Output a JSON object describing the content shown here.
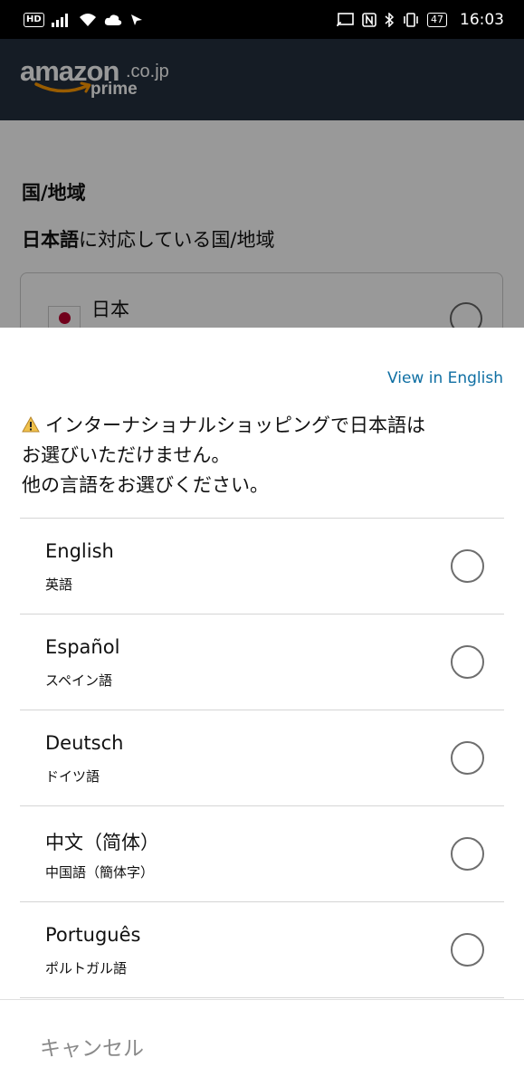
{
  "status_bar": {
    "left_badge": "HD",
    "battery_level": "47",
    "time": "16:03"
  },
  "header": {
    "logo_word": "amazon",
    "logo_domain": ".co.jp",
    "logo_tier": "prime",
    "background_color": "#232f3e"
  },
  "background_page": {
    "heading": "国/地域",
    "subheading_bold": "日本語",
    "subheading_rest": "に対応している国/地域",
    "country": "日本"
  },
  "sheet": {
    "view_in_english": "View in English",
    "notice_line1": "インターナショナルショッピングで日本語は",
    "notice_line2": "お選びいただけません。",
    "notice_line3": "他の言語をお選びください。",
    "languages": [
      {
        "name": "English",
        "native": "英語"
      },
      {
        "name": "Español",
        "native": "スペイン語"
      },
      {
        "name": "Deutsch",
        "native": "ドイツ語"
      },
      {
        "name": "中文（简体）",
        "native": "中国語（簡体字）"
      },
      {
        "name": "Português",
        "native": "ポルトガル語"
      }
    ],
    "cancel_label": "キャンセル",
    "link_color": "#0f6fa3"
  }
}
